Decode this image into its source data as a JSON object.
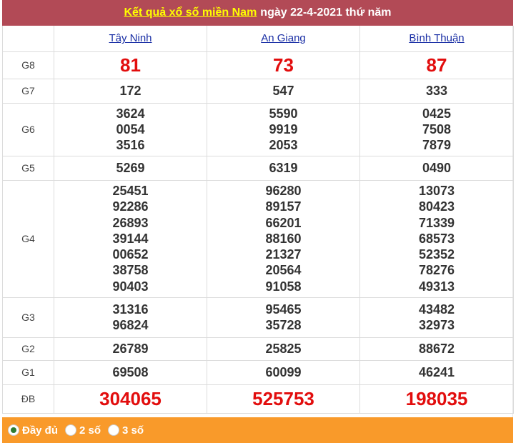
{
  "header": {
    "title_link": "Kết quả xổ số miền Nam",
    "title_rest": "ngày 22-4-2021 thứ năm"
  },
  "provinces": [
    "Tây Ninh",
    "An Giang",
    "Bình Thuận"
  ],
  "prizes": [
    {
      "label": "G8",
      "values": [
        [
          "81"
        ],
        [
          "73"
        ],
        [
          "87"
        ]
      ]
    },
    {
      "label": "G7",
      "values": [
        [
          "172"
        ],
        [
          "547"
        ],
        [
          "333"
        ]
      ]
    },
    {
      "label": "G6",
      "values": [
        [
          "3624",
          "0054",
          "3516"
        ],
        [
          "5590",
          "9919",
          "2053"
        ],
        [
          "0425",
          "7508",
          "7879"
        ]
      ]
    },
    {
      "label": "G5",
      "values": [
        [
          "5269"
        ],
        [
          "6319"
        ],
        [
          "0490"
        ]
      ]
    },
    {
      "label": "G4",
      "values": [
        [
          "25451",
          "92286",
          "26893",
          "39144",
          "00652",
          "38758",
          "90403"
        ],
        [
          "96280",
          "89157",
          "66201",
          "88160",
          "21327",
          "20564",
          "91058"
        ],
        [
          "13073",
          "80423",
          "71339",
          "68573",
          "52352",
          "78276",
          "49313"
        ]
      ]
    },
    {
      "label": "G3",
      "values": [
        [
          "31316",
          "96824"
        ],
        [
          "95465",
          "35728"
        ],
        [
          "43482",
          "32973"
        ]
      ]
    },
    {
      "label": "G2",
      "values": [
        [
          "26789"
        ],
        [
          "25825"
        ],
        [
          "88672"
        ]
      ]
    },
    {
      "label": "G1",
      "values": [
        [
          "69508"
        ],
        [
          "60099"
        ],
        [
          "46241"
        ]
      ]
    },
    {
      "label": "ĐB",
      "values": [
        [
          "304065"
        ],
        [
          "525753"
        ],
        [
          "198035"
        ]
      ]
    }
  ],
  "footer": {
    "options": [
      "Đầy đủ",
      "2 số",
      "3 số"
    ],
    "selected": 0
  },
  "colors": {
    "title_bg": "#b24a56",
    "title_link": "#ffff00",
    "province_link": "#1a2fa5",
    "highlight_number": "#e20d0d",
    "footer_bg": "#f99a2a"
  }
}
